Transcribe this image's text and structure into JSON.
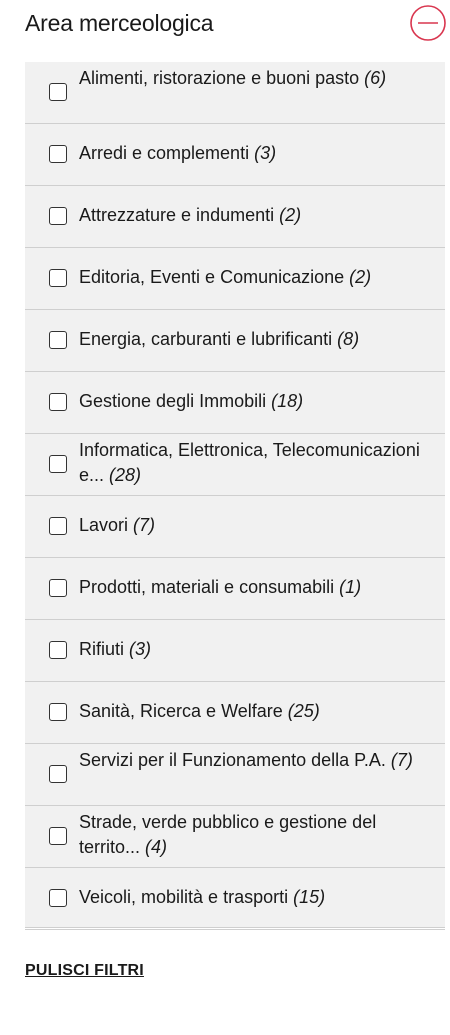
{
  "filter": {
    "title": "Area merceologica",
    "accent_color": "#d9364f",
    "toggle_icon": "minus-circle-icon",
    "items": [
      {
        "label": "Alimenti, ristorazione e buoni pasto",
        "count": "(6)",
        "checked": false
      },
      {
        "label": "Arredi e complementi",
        "count": "(3)",
        "checked": false
      },
      {
        "label": "Attrezzature e indumenti",
        "count": "(2)",
        "checked": false
      },
      {
        "label": "Editoria, Eventi e Comunicazione",
        "count": "(2)",
        "checked": false
      },
      {
        "label": "Energia, carburanti e lubrificanti",
        "count": "(8)",
        "checked": false
      },
      {
        "label": "Gestione degli Immobili",
        "count": "(18)",
        "checked": false
      },
      {
        "label": "Informatica, Elettronica, Telecomunicazioni e...",
        "count": "(28)",
        "checked": false
      },
      {
        "label": "Lavori",
        "count": "(7)",
        "checked": false
      },
      {
        "label": "Prodotti, materiali e consumabili",
        "count": "(1)",
        "checked": false
      },
      {
        "label": "Rifiuti",
        "count": "(3)",
        "checked": false
      },
      {
        "label": "Sanità, Ricerca e Welfare",
        "count": "(25)",
        "checked": false
      },
      {
        "label": "Servizi per il Funzionamento della P.A.",
        "count": "(7)",
        "checked": false
      },
      {
        "label": "Strade, verde pubblico e gestione del territo...",
        "count": "(4)",
        "checked": false
      },
      {
        "label": "Veicoli, mobilità e trasporti",
        "count": "(15)",
        "checked": false
      }
    ],
    "clear_label": "PULISCI FILTRI"
  }
}
